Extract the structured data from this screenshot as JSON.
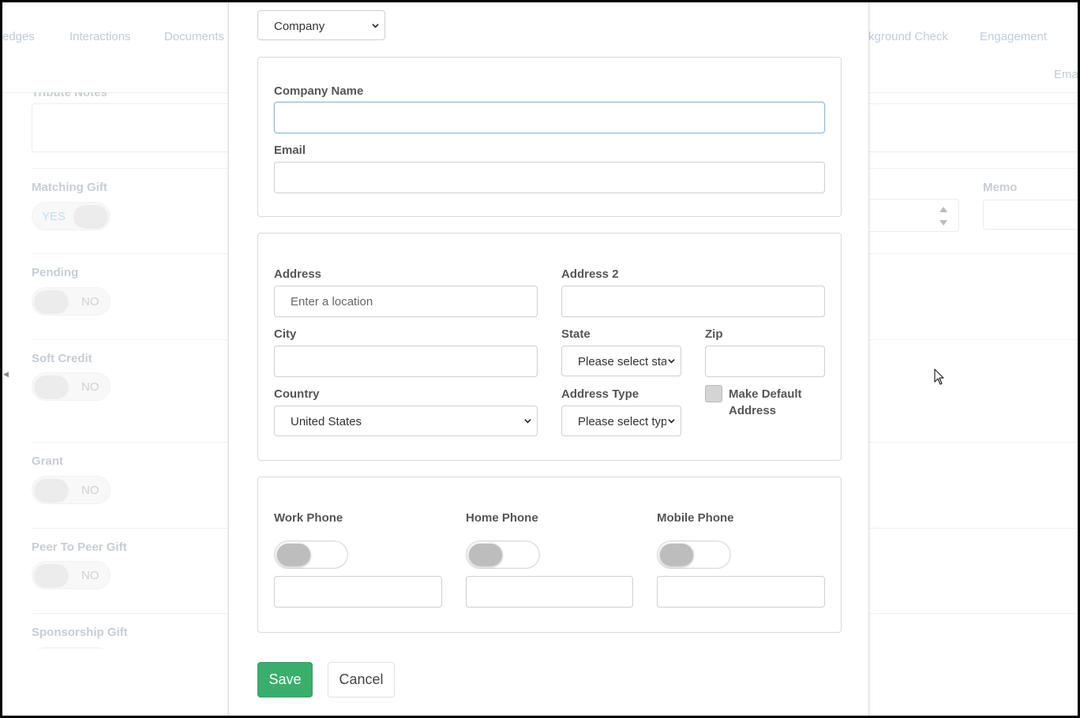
{
  "background": {
    "tabs": [
      "edges",
      "Interactions",
      "Documents",
      "kground Check",
      "Engagement"
    ],
    "email_tab": "Ema",
    "tribute_notes_label": "Tribute Notes",
    "memo_label": "Memo",
    "toggles": [
      {
        "label": "Matching Gift",
        "state": "YES"
      },
      {
        "label": "Pending",
        "state": "NO"
      },
      {
        "label": "Soft Credit",
        "state": "NO"
      },
      {
        "label": "Grant",
        "state": "NO"
      },
      {
        "label": "Peer To Peer Gift",
        "state": "NO"
      },
      {
        "label": "Sponsorship Gift",
        "state": ""
      }
    ]
  },
  "modal": {
    "type_select": "Company",
    "company": {
      "company_name_label": "Company Name",
      "company_name_value": "",
      "email_label": "Email",
      "email_value": ""
    },
    "address": {
      "address_label": "Address",
      "address_placeholder": "Enter a location",
      "address2_label": "Address 2",
      "city_label": "City",
      "state_label": "State",
      "state_value": "Please select state",
      "zip_label": "Zip",
      "country_label": "Country",
      "country_value": "United States",
      "address_type_label": "Address Type",
      "address_type_value": "Please select type",
      "default_address_label_1": "Make Default",
      "default_address_label_2": "Address"
    },
    "phones": {
      "work_label": "Work Phone",
      "home_label": "Home Phone",
      "mobile_label": "Mobile Phone"
    },
    "save_label": "Save",
    "cancel_label": "Cancel"
  },
  "colors": {
    "save_button": "#3aae6b",
    "tab_text": "#9fb1c5",
    "focus_border": "#8fb8d8"
  }
}
